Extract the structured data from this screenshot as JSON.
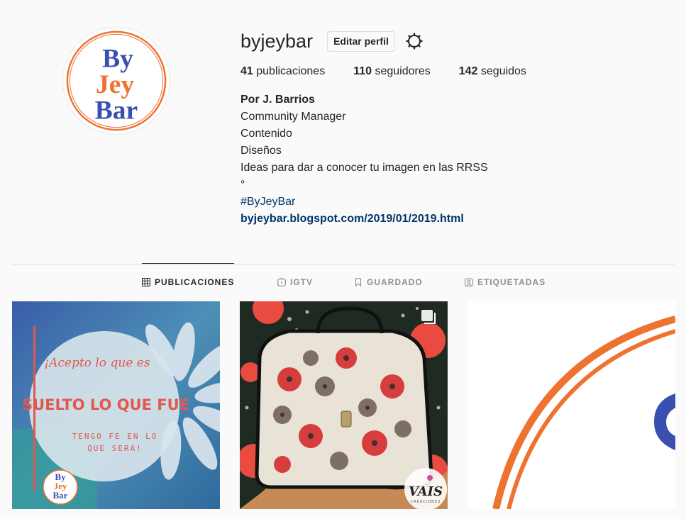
{
  "profile": {
    "username": "byjeybar",
    "edit_button": "Editar perfil",
    "settings_icon": "gear-icon",
    "avatar_logo": {
      "line1": "By",
      "line2": "Jey",
      "line3": "Bar"
    },
    "stats": {
      "posts_count": "41",
      "posts_label": "publicaciones",
      "followers_count": "110",
      "followers_label": "seguidores",
      "following_count": "142",
      "following_label": "seguidos"
    },
    "bio": {
      "name": "Por J. Barrios",
      "lines": [
        "Community Manager",
        "Contenido",
        "Diseños",
        "Ideas para dar a conocer tu imagen en las RRSS",
        "°"
      ],
      "hashtag": "#ByJeyBar",
      "link": "byjeybar.blogspot.com/2019/01/2019.html"
    }
  },
  "tabs": [
    {
      "label": "PUBLICACIONES",
      "icon": "grid-icon",
      "active": true
    },
    {
      "label": "IGTV",
      "icon": "igtv-icon",
      "active": false
    },
    {
      "label": "GUARDADO",
      "icon": "bookmark-icon",
      "active": false
    },
    {
      "label": "ETIQUETADAS",
      "icon": "tag-person-icon",
      "active": false
    }
  ],
  "posts": [
    {
      "line1": "¡Acepto lo que es",
      "line2": "SUELTO LO QUE FUE",
      "line3": "TENGO FE EN LO",
      "line4": "QUE SERA!",
      "logo": {
        "line1": "By",
        "line2": "Jey",
        "line3": "Bar"
      }
    },
    {
      "watermark": "VAIS",
      "watermark_sub": "CREACIONES",
      "multi_icon": "carousel-icon"
    },
    {}
  ],
  "colors": {
    "accent_blue": "#3b4fb0",
    "accent_orange": "#ee7230",
    "link": "#00376b",
    "muted": "#8e8e8e",
    "border": "#dbdbdb"
  }
}
